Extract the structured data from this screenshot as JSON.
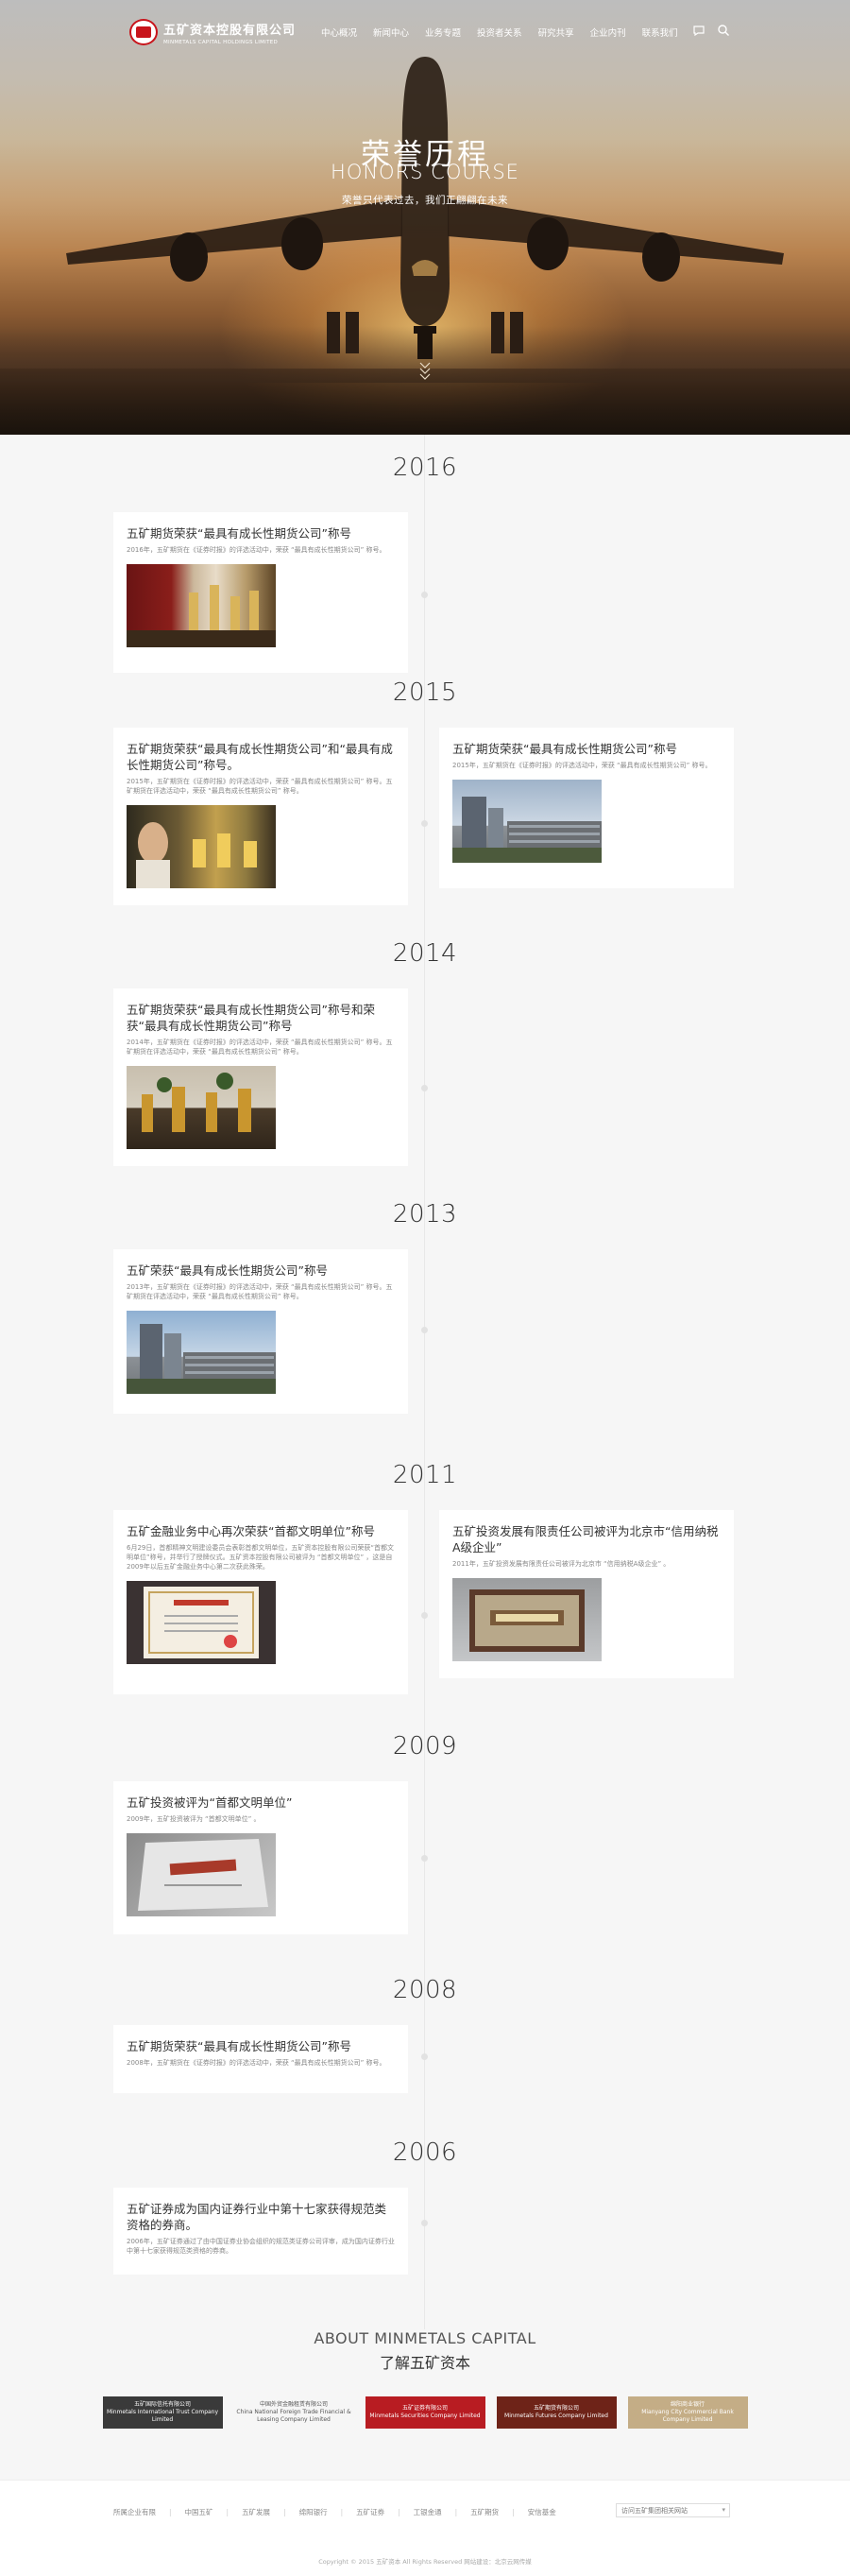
{
  "header": {
    "logo_cn": "五矿资本控股有限公司",
    "logo_en": "MINMETALS CAPITAL HOLDINGS LIMITED",
    "nav": [
      "中心概况",
      "新闻中心",
      "业务专题",
      "投资者关系",
      "研究共享",
      "企业内刊",
      "联系我们"
    ],
    "icons": [
      "chat-icon",
      "search-icon"
    ]
  },
  "hero": {
    "title_cn": "荣誉历程",
    "title_en": "HONORS COURSE",
    "subtitle": "荣誉只代表过去，我们正翩翩在未来"
  },
  "timeline": [
    {
      "year": "2016",
      "cards": [
        {
          "side": "left",
          "title": "五矿期货荣获“最具有成长性期货公司”称号",
          "text": "2016年，五矿期货在《证券时报》的评选活动中，荣获 “最具有成长性期货公司” 称号。",
          "photo": "trophies-red"
        }
      ]
    },
    {
      "year": "2015",
      "cards": [
        {
          "side": "left",
          "title": "五矿期货荣获“最具有成长性期货公司”和“最具有成长性期货公司”称号。",
          "text": "2015年，五矿期货在《证券时报》的评选活动中，荣获 “最具有成长性期货公司” 称号。五矿期货在评选活动中，荣获 “最具有成长性期货公司” 称号。",
          "photo": "man-trophy"
        },
        {
          "side": "right",
          "title": "五矿期货荣获“最具有成长性期货公司”称号",
          "text": "2015年，五矿期货在《证券时报》的评选活动中，荣获 “最具有成长性期货公司” 称号。",
          "photo": "building"
        }
      ]
    },
    {
      "year": "2014",
      "cards": [
        {
          "side": "left",
          "title": "五矿期货荣获“最具有成长性期货公司”称号和荣获“最具有成长性期货公司”称号",
          "text": "2014年，五矿期货在《证券时报》的评选活动中，荣获 “最具有成长性期货公司” 称号。五矿期货在评选活动中，荣获 “最具有成长性期货公司” 称号。",
          "photo": "trophies-gold"
        }
      ]
    },
    {
      "year": "2013",
      "cards": [
        {
          "side": "left",
          "title": "五矿荣获“最具有成长性期货公司”称号",
          "text": "2013年，五矿期货在《证券时报》的评选活动中，荣获 “最具有成长性期货公司” 称号。五矿期货在评选活动中，荣获 “最具有成长性期货公司” 称号。",
          "photo": "building"
        }
      ]
    },
    {
      "year": "2011",
      "cards": [
        {
          "side": "left",
          "title": "五矿金融业务中心再次荣获“首都文明单位”称号",
          "text": "6月29日，首都精神文明建设委员会表彰首都文明单位，五矿资本控股有限公司荣获“首都文明单位”称号，并举行了授牌仪式。五矿资本控股有限公司被评为 “首都文明单位” ，这是自2009年以后五矿金融业务中心第二次获此殊荣。",
          "photo": "certificate"
        },
        {
          "side": "right",
          "title": "五矿投资发展有限责任公司被评为北京市“信用纳税A级企业”",
          "text": "2011年，五矿投资发展有限责任公司被评为北京市 “信用纳税A级企业” 。",
          "photo": "tax-plaque"
        }
      ]
    },
    {
      "year": "2009",
      "cards": [
        {
          "side": "left",
          "title": "五矿投资被评为“首都文明单位”",
          "text": "2009年，五矿投资被评为 “首都文明单位” 。",
          "photo": "plaque"
        }
      ]
    },
    {
      "year": "2008",
      "cards": [
        {
          "side": "left",
          "title": "五矿期货荣获“最具有成长性期货公司”称号",
          "text": "2008年，五矿期货在《证券时报》的评选活动中，荣获 “最具有成长性期货公司” 称号。",
          "photo": null
        }
      ]
    },
    {
      "year": "2006",
      "cards": [
        {
          "side": "left",
          "title": "五矿证券成为国内证券行业中第十七家获得规范类资格的券商。",
          "text": "2006年，五矿证券通过了由中国证券业协会组织的规范类证券公司评审，成为国内证券行业中第十七家获得规范类资格的券商。",
          "photo": null
        }
      ]
    }
  ],
  "about": {
    "title_en": "ABOUT MINMETALS CAPITAL",
    "title_cn": "了解五矿资本",
    "partners": [
      {
        "cn": "五矿国际信托有限公司",
        "en": "Minmetals International Trust Company Limited",
        "bg": "#3a3a3a",
        "fg": "#ffffff"
      },
      {
        "cn": "中国外贸金融租赁有限公司",
        "en": "China National Foreign Trade Financial & Leasing Company Limited",
        "bg": "#f6f6f6",
        "fg": "#555555"
      },
      {
        "cn": "五矿证券有限公司",
        "en": "Minmetals Securities Company Limited",
        "bg": "#b81c22",
        "fg": "#ffffff"
      },
      {
        "cn": "五矿期货有限公司",
        "en": "Minmetals Futures Company Limited",
        "bg": "#6e2318",
        "fg": "#ffffff"
      },
      {
        "cn": "绵阳商业银行",
        "en": "Mianyang City Commercial Bank Company Limited",
        "bg": "#c4ad86",
        "fg": "#ffffff"
      }
    ]
  },
  "footer": {
    "links": [
      "所属企业有限",
      "中国五矿",
      "五矿发展",
      "绵阳银行",
      "五矿证券",
      "工银金通",
      "五矿期货",
      "安信基金"
    ],
    "select_label": "访问五矿集团相关网站",
    "copyright": "Copyright © 2015 五矿资本 All Rights Reserved    网站建设：北京云网传媒"
  }
}
